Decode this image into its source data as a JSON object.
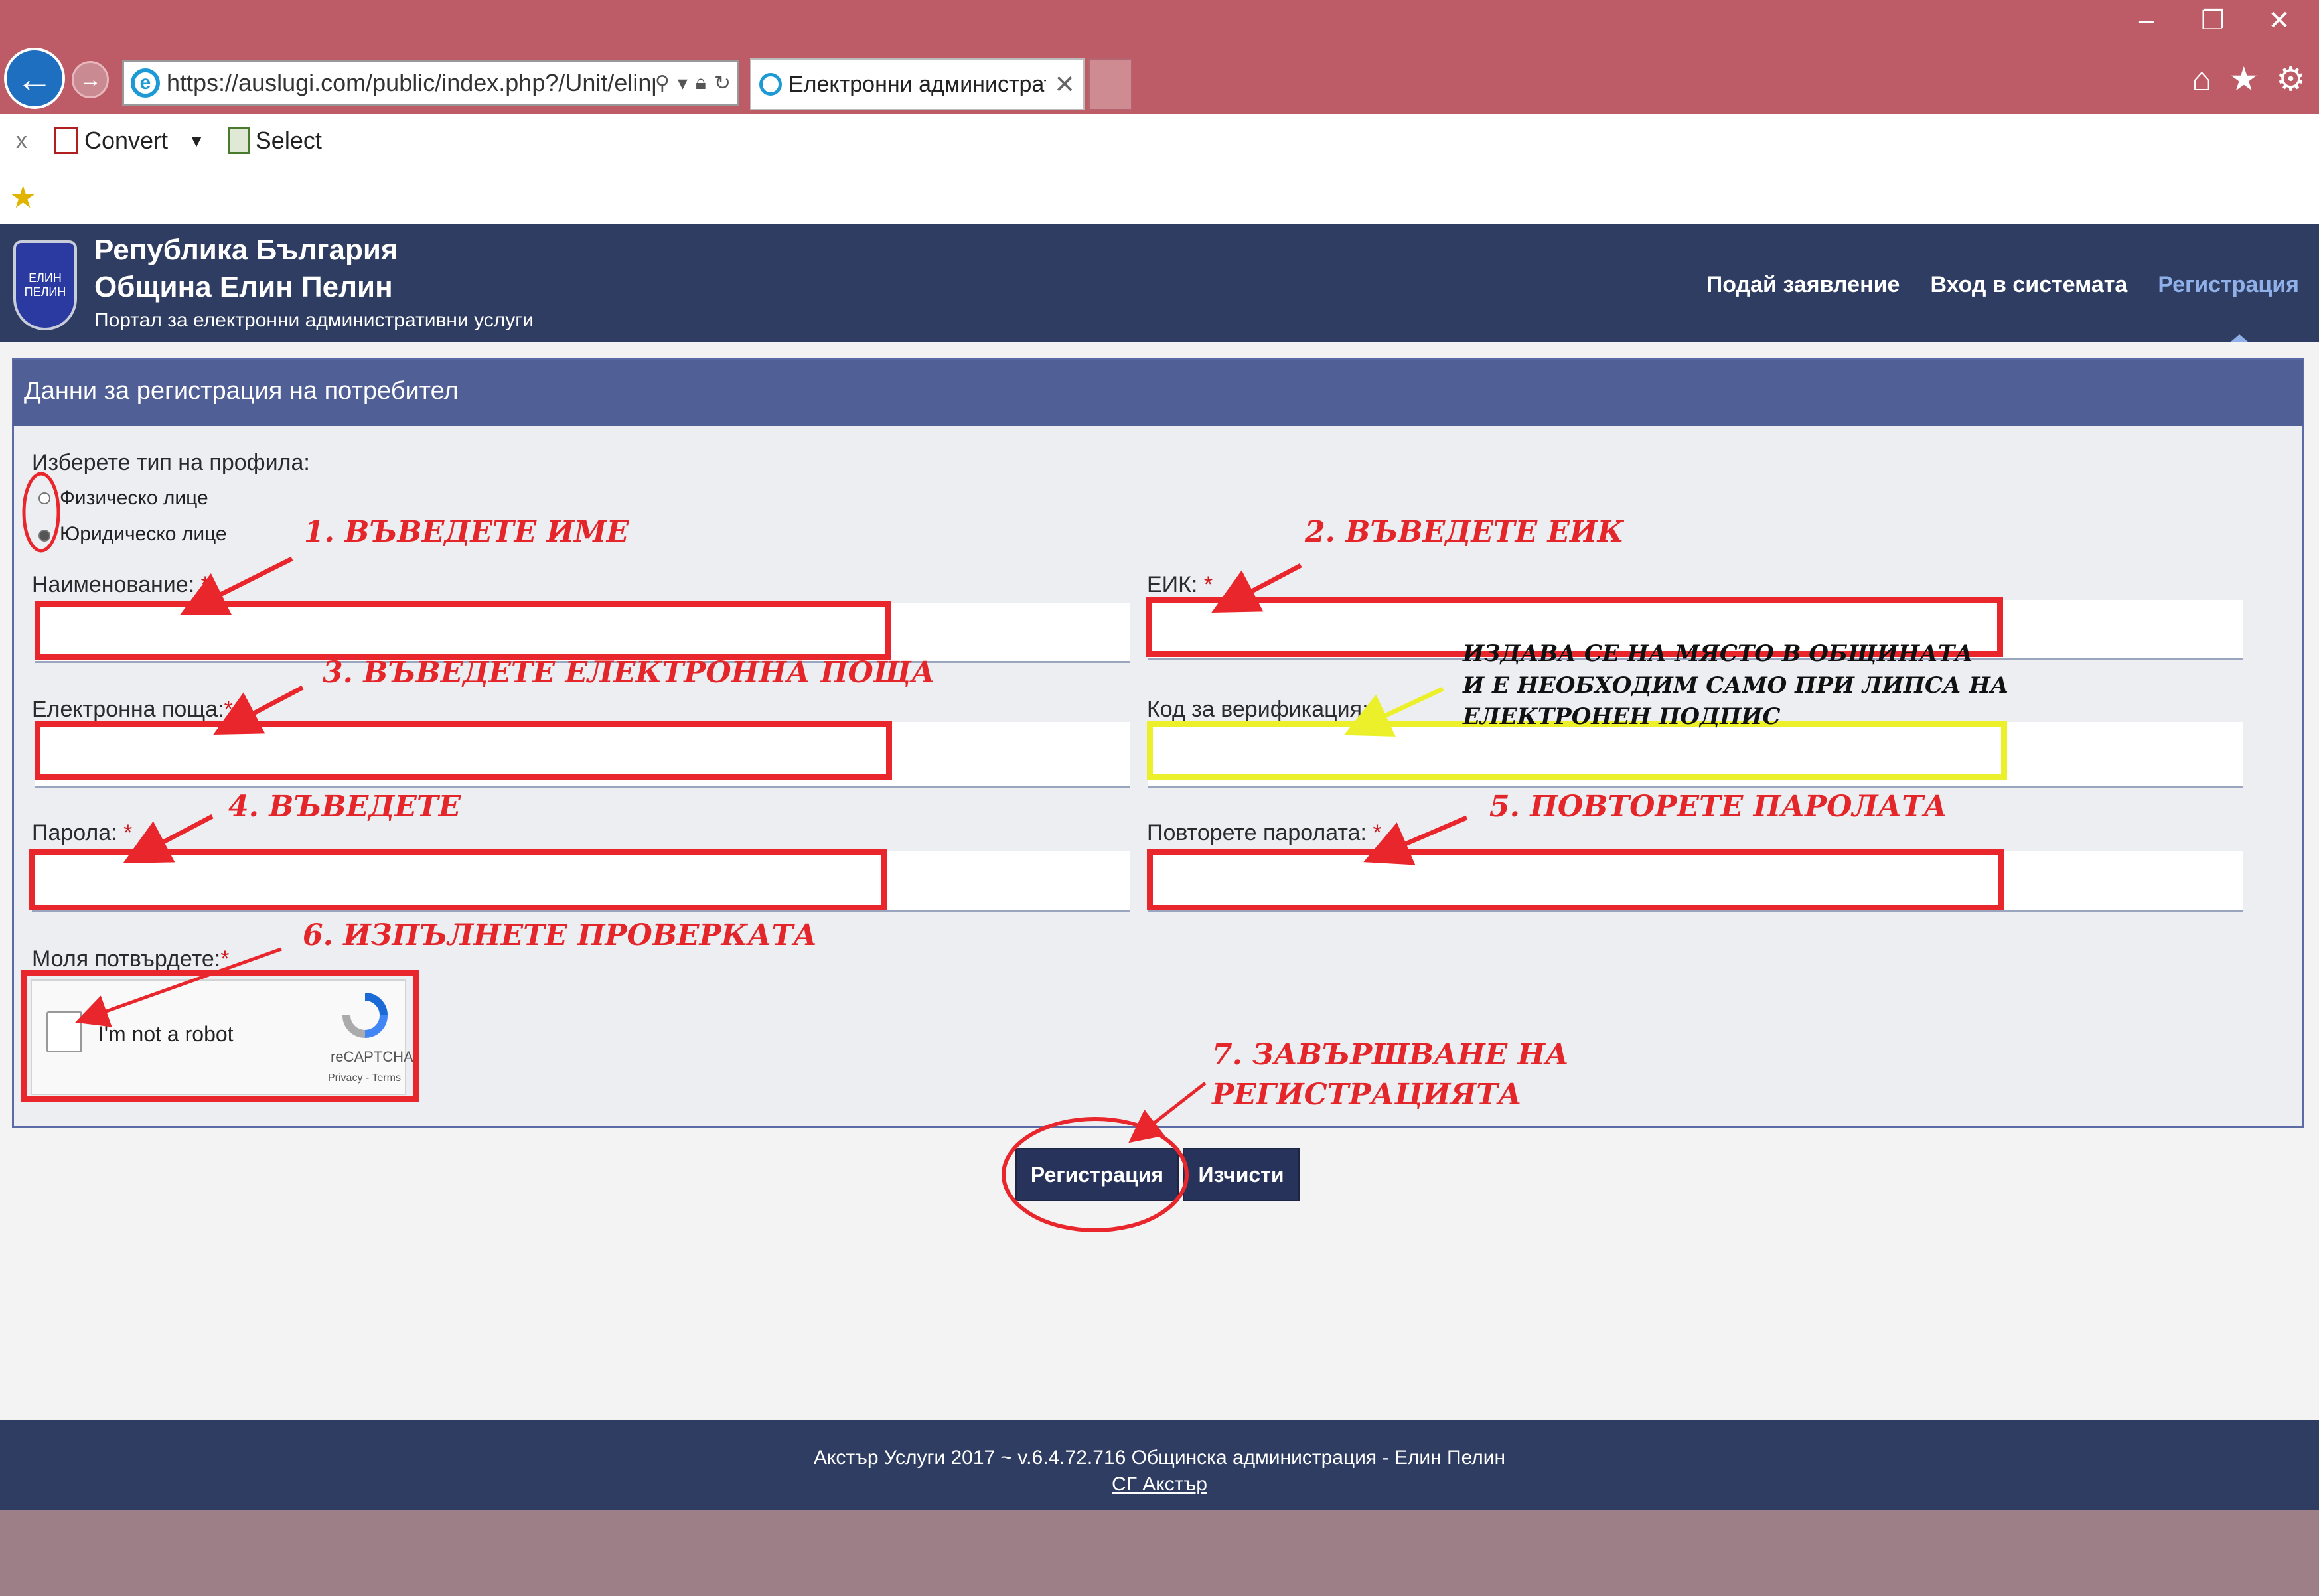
{
  "browser": {
    "url": "https://auslugi.com/public/index.php?/Unit/elinpe",
    "tab_title": "Електронни администрати...",
    "toolbar": {
      "close": "x",
      "convert": "Convert",
      "select": "Select"
    },
    "window_controls": [
      "–",
      "❐",
      "✕"
    ]
  },
  "header": {
    "line1": "Република България",
    "line2": "Община Елин Пелин",
    "line3": "Портал за електронни административни услуги",
    "nav": [
      "Подай заявление",
      "Вход в системата",
      "Регистрация"
    ],
    "active_nav": "Регистрация"
  },
  "form": {
    "title": "Данни за регистрация на потребител",
    "profile_type_label": "Изберете тип на профила:",
    "profile_options": [
      "Физическо лице",
      "Юридическо лице"
    ],
    "name_label": "Наименование:",
    "eik_label": "ЕИК:",
    "email_label": "Електронна поща:",
    "verification_label": "Код за верификация:",
    "password_label": "Парола:",
    "repeat_password_label": "Повторете паролата:",
    "confirm_label": "Моля потвърдете:",
    "required_mark": "*",
    "captcha_text": "I'm not a robot",
    "captcha_brand": "reCAPTCHA",
    "captcha_terms": "Privacy - Terms",
    "register_button": "Регистрация",
    "clear_button": "Изчисти"
  },
  "annotations": {
    "step1": "1. ВЪВЕДЕТЕ ИМЕ",
    "step2": "2. ВЪВЕДЕТЕ ЕИК",
    "step3": "3. ВЪВЕДЕТЕ ЕЛЕКТРОННА ПОЩА",
    "step4": "4. ВЪВЕДЕТЕ",
    "step5": "5. ПОВТОРЕТЕ ПАРОЛАТА",
    "step6": "6. ИЗПЪЛНЕТЕ ПРОВЕРКАТА",
    "step7_line1": "7. ЗАВЪРШВАНЕ НА",
    "step7_line2": "РЕГИСТРАЦИЯТА",
    "note_line1": "ИЗДАВА СЕ НА МЯСТО В ОБЩИНАТА",
    "note_line2": "И Е НЕОБХОДИМ САМО ПРИ ЛИПСА НА",
    "note_line3": "ЕЛЕКТРОНЕН  ПОДПИС"
  },
  "footer": {
    "line": "Акстър Услуги 2017 ~ v.6.4.72.716 Общинска администрация - Елин Пелин",
    "link": "СГ Акстър"
  },
  "colors": {
    "browser_chrome": "#bd5b66",
    "header_bg": "#2e3d61",
    "panel_head": "#505f96",
    "annotation_red": "#e8262b",
    "annotation_yellow": "#ecf02a",
    "active_nav": "#8fb0e8"
  },
  "icons": [
    "back-arrow-icon",
    "forward-arrow-icon",
    "ie-icon",
    "search-icon",
    "lock-icon",
    "refresh-icon",
    "home-icon",
    "star-icon",
    "gear-icon",
    "favorites-star-icon",
    "coat-of-arms-icon",
    "recaptcha-icon"
  ]
}
